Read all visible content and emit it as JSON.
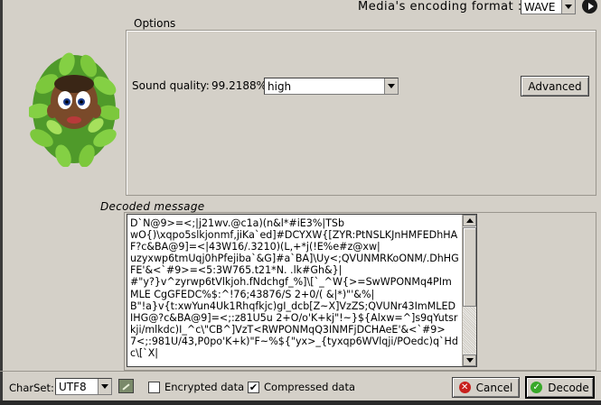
{
  "header": {
    "format_label": "Media's encoding format :",
    "format_value": "WAVE"
  },
  "options": {
    "title": "Options",
    "sound_quality_label": "Sound quality:",
    "sound_quality_percent": "99.2188%",
    "sound_quality_value": "high",
    "advanced_label": "Advanced"
  },
  "decoded": {
    "title": "Decoded message",
    "text": "D`N@9>=<;|j21wv.@c1a)(n&l*#iE3%|TSb\nwO{)\\xqpo5slkjonmf,jiKa`ed]#DCYXW{[ZYR:PtNSLKJnHMFEDhHA\nF?c&BA@9]=<|43W16/.3210)(L,+*j(!E%e#z@xw|\nuzyxwp6tmUqj0hPfejiba`&G]#a`BA]\\Uy<;QVUNMRKoONM/.DhHG\nFE'&<`#9>=<5:3W765.t21*N. .lk#Gh&}|\n#\"y?}v^zyrwp6tVlkjoh.fNdchgf_%]\\[`_^W{>=SwWPONMq4PIm\nMLE CgGFEDC%$:^!76;43876/S 2+0/( &|*)\"'&%|\nB\"!a}v{t:xwYun4Uk1Rhqfkjc)gI_dcb[Z~X]VzZS;QVUNr43ImMLED\nIHG@?c&BA@9]=<;:z81U5u 2+O/o'K+kj\"!~}${Alxw=^]s9qYutsr\nkji/mlkdc)I_^c\\\"CB^]VzT<RWPONMqQ3INMFjDCHAeE'&<`#9>\n7<;:981U/43,P0po'K+k)\"F~%${\"yx>_{tyxqp6WVlqji/POedc)q`Hd\nc\\[`X|"
  },
  "bottom": {
    "charset_label": "CharSet:",
    "charset_value": "UTF8",
    "encrypted_label": "Encrypted data",
    "encrypted_checked": false,
    "compressed_label": "Compressed data",
    "compressed_checked": true,
    "cancel_label": "Cancel",
    "decode_label": "Decode"
  }
}
